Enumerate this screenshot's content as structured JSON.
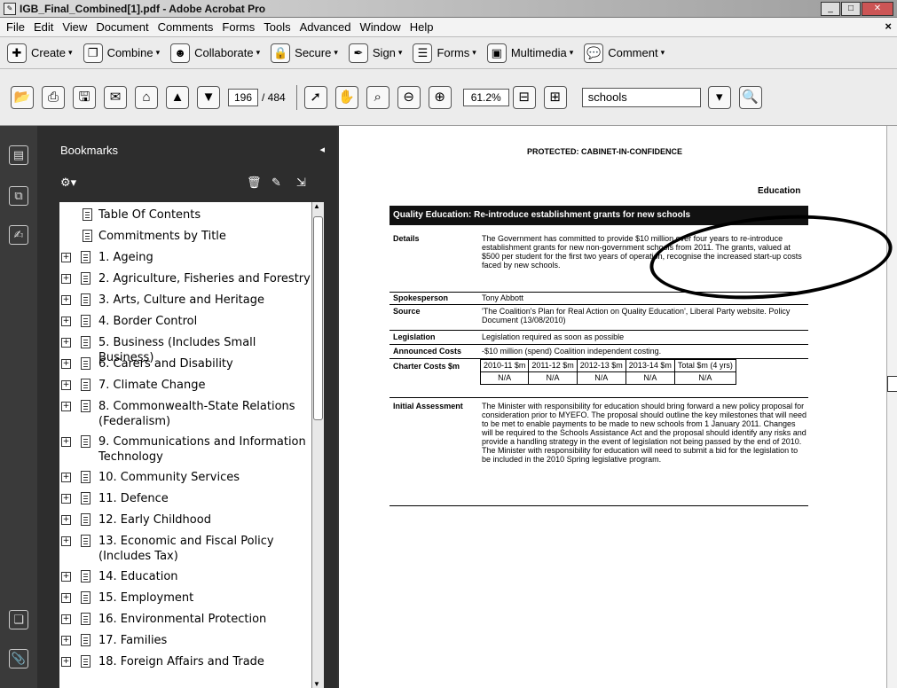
{
  "window": {
    "title": "IGB_Final_Combined[1].pdf - Adobe Acrobat Pro",
    "app_icon": "acrobat-icon",
    "controls": [
      "minimize",
      "maximize",
      "close"
    ]
  },
  "menu": {
    "items": [
      "File",
      "Edit",
      "View",
      "Document",
      "Comments",
      "Forms",
      "Tools",
      "Advanced",
      "Window",
      "Help"
    ],
    "close_glyph": "×"
  },
  "tasks": [
    {
      "label": "Create",
      "icon": "create-icon"
    },
    {
      "label": "Combine",
      "icon": "combine-icon"
    },
    {
      "label": "Collaborate",
      "icon": "collaborate-icon"
    },
    {
      "label": "Secure",
      "icon": "secure-icon"
    },
    {
      "label": "Sign",
      "icon": "sign-icon"
    },
    {
      "label": "Forms",
      "icon": "forms-icon"
    },
    {
      "label": "Multimedia",
      "icon": "multimedia-icon"
    },
    {
      "label": "Comment",
      "icon": "comment-icon"
    }
  ],
  "nav": {
    "current_page": "196",
    "total_pages": "/ 484",
    "zoom": "61.2%",
    "search": "schools"
  },
  "bookmarks": {
    "title": "Bookmarks",
    "items": [
      {
        "label": "Table Of Contents",
        "expandable": false
      },
      {
        "label": "Commitments by Title",
        "expandable": false
      },
      {
        "label": "1. Ageing",
        "expandable": true
      },
      {
        "label": "2. Agriculture, Fisheries and Forestry",
        "expandable": true
      },
      {
        "label": "3. Arts, Culture and Heritage",
        "expandable": true
      },
      {
        "label": "4. Border Control",
        "expandable": true
      },
      {
        "label": "5. Business (Includes Small Business)",
        "expandable": true
      },
      {
        "label": "6. Carers and Disability",
        "expandable": true
      },
      {
        "label": "7. Climate Change",
        "expandable": true
      },
      {
        "label": "8. Commonwealth-State Relations",
        "label2": "(Federalism)",
        "expandable": true
      },
      {
        "label": "9. Communications and Information",
        "label2": "Technology",
        "expandable": true
      },
      {
        "label": "10. Community Services",
        "expandable": true
      },
      {
        "label": "11. Defence",
        "expandable": true
      },
      {
        "label": "12. Early Childhood",
        "expandable": true
      },
      {
        "label": "13. Economic and Fiscal Policy",
        "label2": "(Includes Tax)",
        "expandable": true
      },
      {
        "label": "14. Education",
        "expandable": true
      },
      {
        "label": "15. Employment",
        "expandable": true
      },
      {
        "label": "16. Environmental Protection",
        "expandable": true
      },
      {
        "label": "17. Families",
        "expandable": true
      },
      {
        "label": "18. Foreign Affairs and Trade",
        "expandable": true
      }
    ]
  },
  "document": {
    "classification": "PROTECTED: CABINET-IN-CONFIDENCE",
    "portfolio": "Education",
    "heading": "Quality Education: Re-introduce establishment grants for new schools",
    "details_label": "Details",
    "details_text": "The Government has committed to provide $10 million over four years to re-introduce establishment grants for new non-government schools from 2011. The grants, valued at $500 per student for the first two years of operation, recognise the increased start-up costs faced by new schools.",
    "spokesperson_label": "Spokesperson",
    "spokesperson": "Tony Abbott",
    "source_label": "Source",
    "source": "'The Coalition's Plan for Real Action on Quality Education', Liberal Party website. Policy Document (13/08/2010)",
    "legislation_label": "Legislation",
    "legislation": "Legislation required as soon as possible",
    "announced_label": "Announced Costs",
    "announced": "-$10 million (spend) Coalition independent costing.",
    "charter_label": "Charter Costs $m",
    "cost_headers": [
      "2010-11 $m",
      "2011-12 $m",
      "2012-13 $m",
      "2013-14 $m",
      "Total $m (4 yrs)"
    ],
    "cost_values": [
      "N/A",
      "N/A",
      "N/A",
      "N/A",
      "N/A"
    ],
    "initial_label": "Initial Assessment",
    "initial_text": "The Minister with responsibility for education should bring forward a new policy proposal for consideration prior to MYEFO. The proposal should outline the key milestones that will need to be met to enable payments to be made to new schools from 1 January 2011. Changes will be required to the Schools Assistance Act and the proposal should identify any risks and provide a handling strategy in the event of legislation not being passed by the end of 2010. The Minister with responsibility for education will need to submit a bid for the legislation to be included in the 2010 Spring legislative program."
  }
}
